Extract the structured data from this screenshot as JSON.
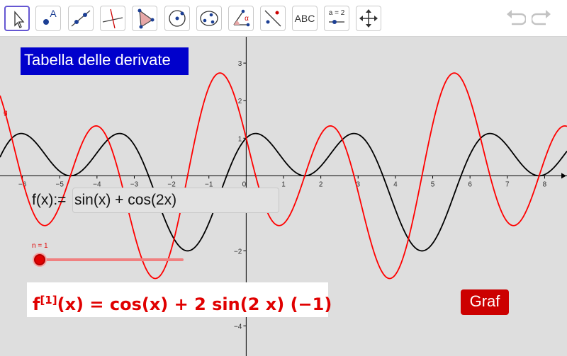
{
  "toolbar": {
    "tools": [
      {
        "name": "move-tool-icon",
        "label": ""
      },
      {
        "name": "point-tool-icon",
        "label": "A"
      },
      {
        "name": "line-tool-icon",
        "label": ""
      },
      {
        "name": "perpendicular-line-tool-icon",
        "label": ""
      },
      {
        "name": "polygon-tool-icon",
        "label": ""
      },
      {
        "name": "circle-tool-icon",
        "label": ""
      },
      {
        "name": "conic-tool-icon",
        "label": ""
      },
      {
        "name": "angle-tool-icon",
        "label": "α"
      },
      {
        "name": "reflect-tool-icon",
        "label": ""
      },
      {
        "name": "text-tool-icon",
        "label": "ABC"
      },
      {
        "name": "slider-tool-icon",
        "label": "a = 2"
      },
      {
        "name": "move-graphics-tool-icon",
        "label": ""
      }
    ],
    "selected_tool": "move-tool-icon",
    "undo_icon": "undo-icon",
    "redo_icon": "redo-icon"
  },
  "title_box": {
    "text": "Tabella delle derivate",
    "background": "#0000cc"
  },
  "input_bar": {
    "label": "f(x):=",
    "value": "sin(x) + cos(2x)"
  },
  "slider": {
    "label": "n = 1",
    "value": 1,
    "fraction": 0,
    "color": "#e00000"
  },
  "formula": {
    "prefix": "f",
    "superscript": "[1]",
    "body": "(x) = cos(x) + 2  sin(2 x) (−1)",
    "color": "#e00000"
  },
  "graf_button": {
    "label": "Graf",
    "background": "#cc0000"
  },
  "graph_label_g": "g",
  "chart_data": {
    "type": "line",
    "x_ticks": [
      "−6",
      "−5",
      "−4",
      "−3",
      "−2",
      "−1",
      "0",
      "1",
      "2",
      "3",
      "4",
      "5",
      "6",
      "7",
      "8"
    ],
    "y_ticks": [
      "3",
      "2",
      "1",
      "−2",
      "−4"
    ],
    "xlim": [
      -6.6,
      8.6
    ],
    "ylim": [
      -4.8,
      3.7
    ],
    "grid": false,
    "series": [
      {
        "expression": "sin(x) + cos(2x)",
        "color": "#000000"
      },
      {
        "name": "g",
        "expression": "cos(x) - 2 sin(2x)",
        "color": "#ff0000"
      }
    ]
  }
}
